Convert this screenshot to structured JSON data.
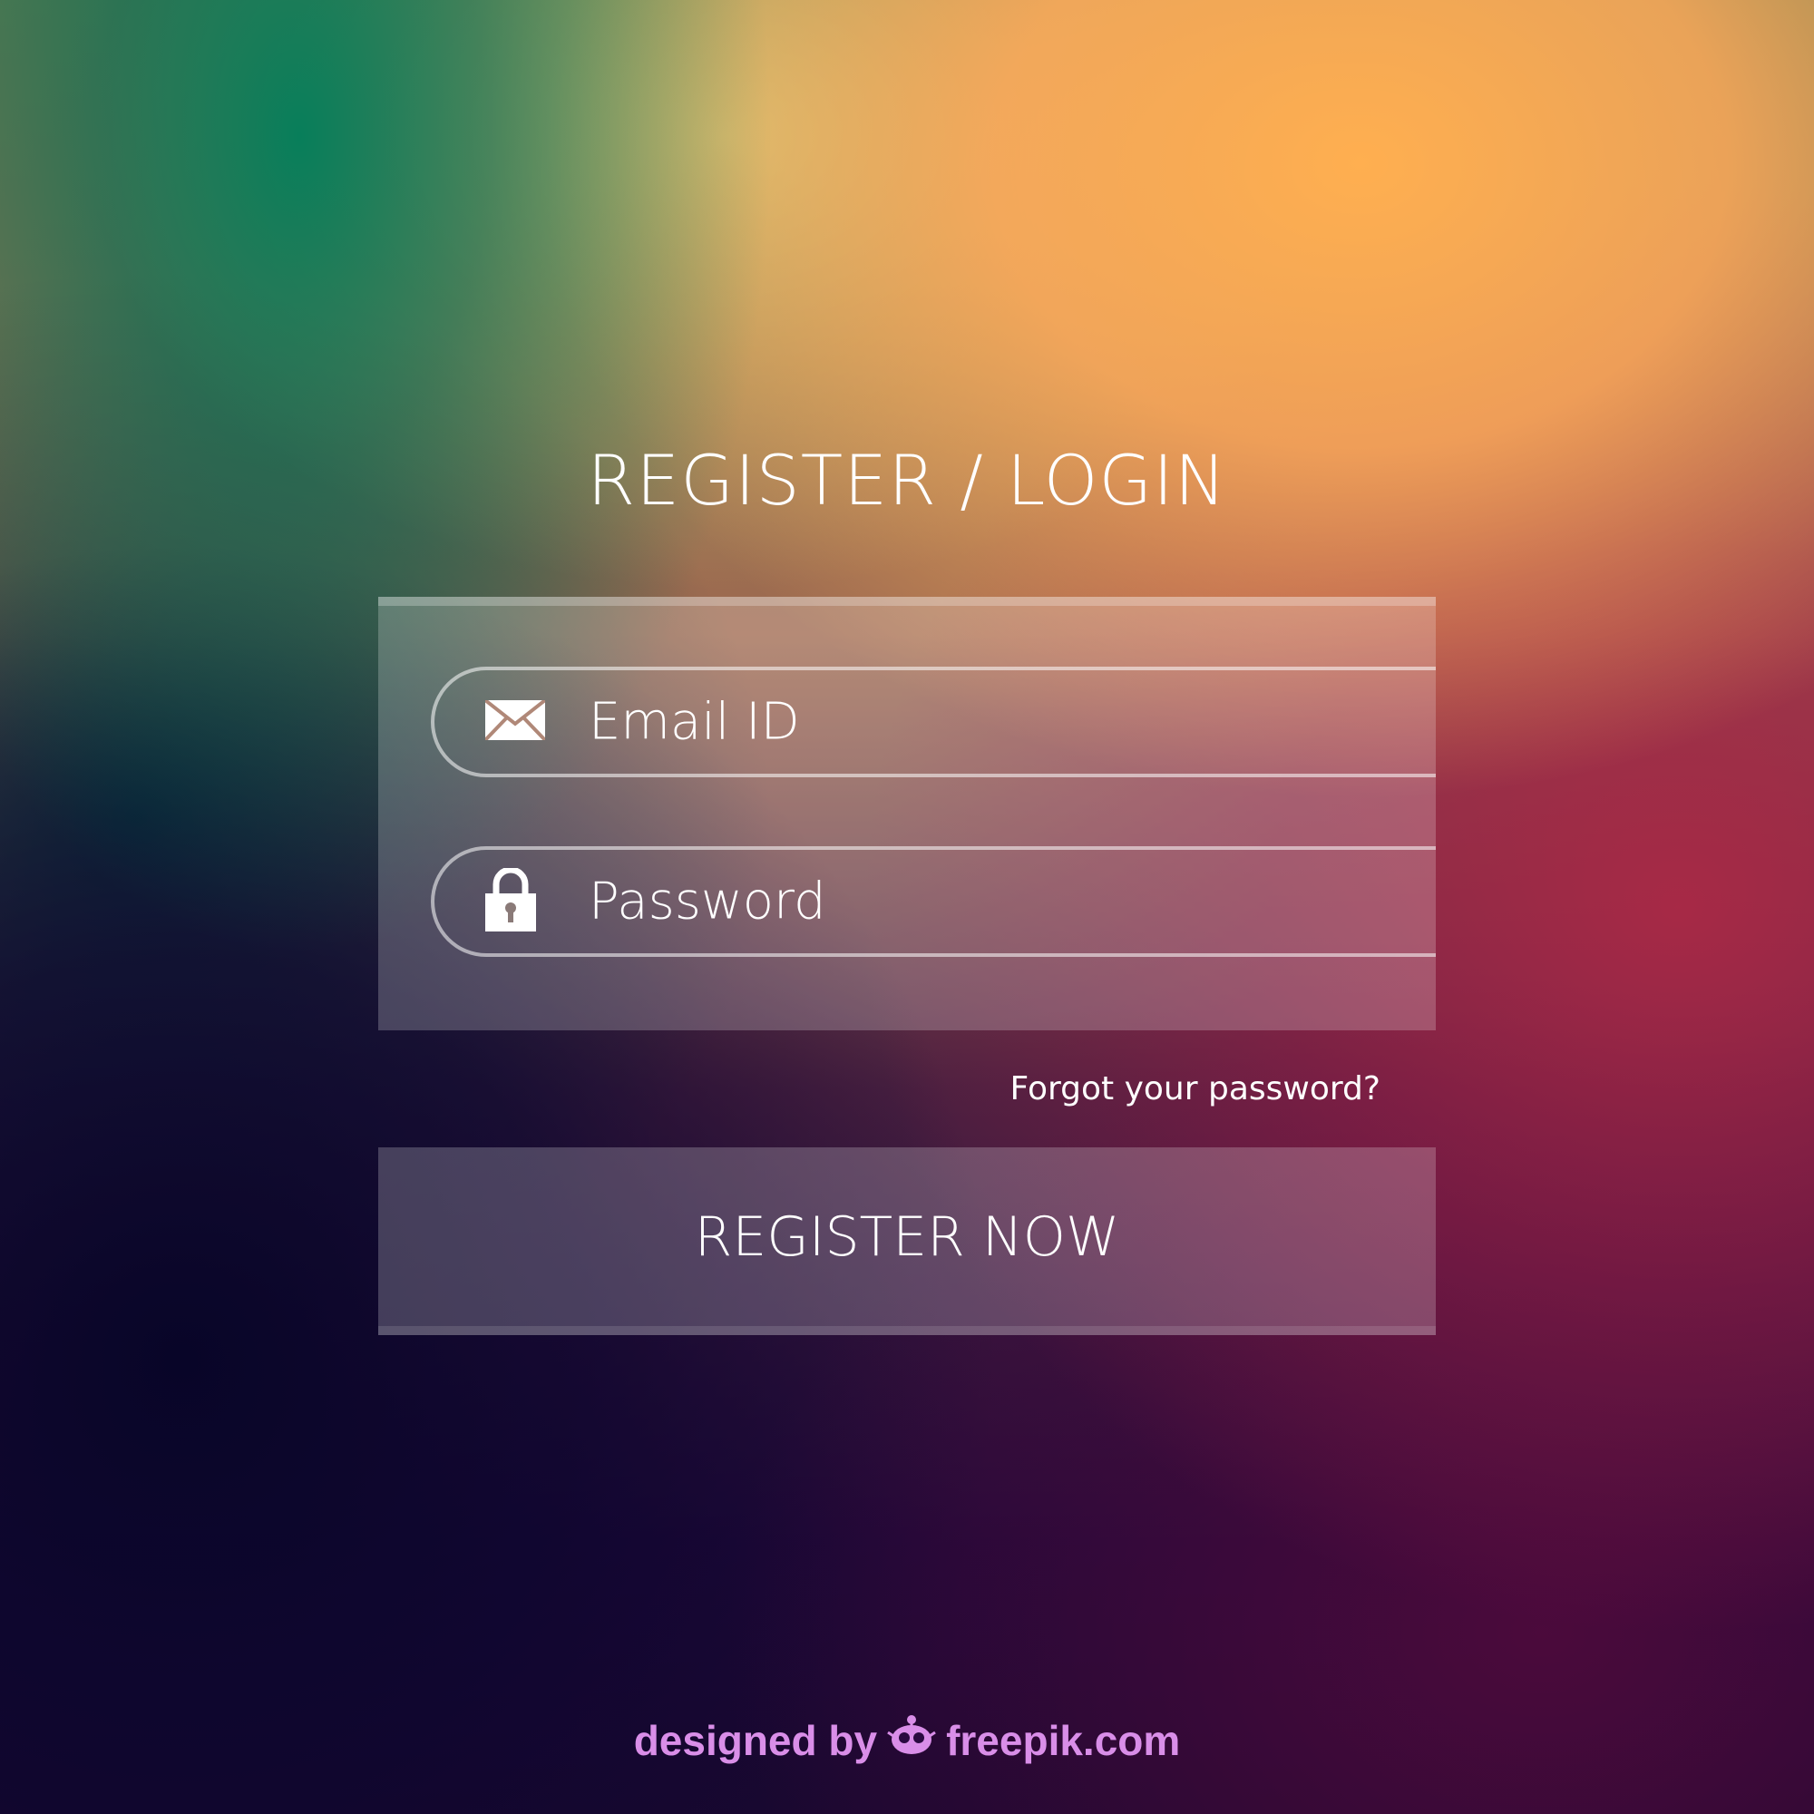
{
  "header": {
    "title": "REGISTER / LOGIN"
  },
  "form": {
    "email": {
      "placeholder": "Email ID",
      "icon": "envelope-icon"
    },
    "password": {
      "placeholder": "Password",
      "icon": "lock-icon"
    },
    "forgot_label": "Forgot your password?",
    "submit_label": "REGISTER NOW"
  },
  "footer": {
    "credit_prefix": "designed by",
    "credit_brand": "freepik.com",
    "brand_icon": "freepik-logo-icon"
  },
  "colors": {
    "text": "#ffffff",
    "credit": "#d98ee8"
  }
}
